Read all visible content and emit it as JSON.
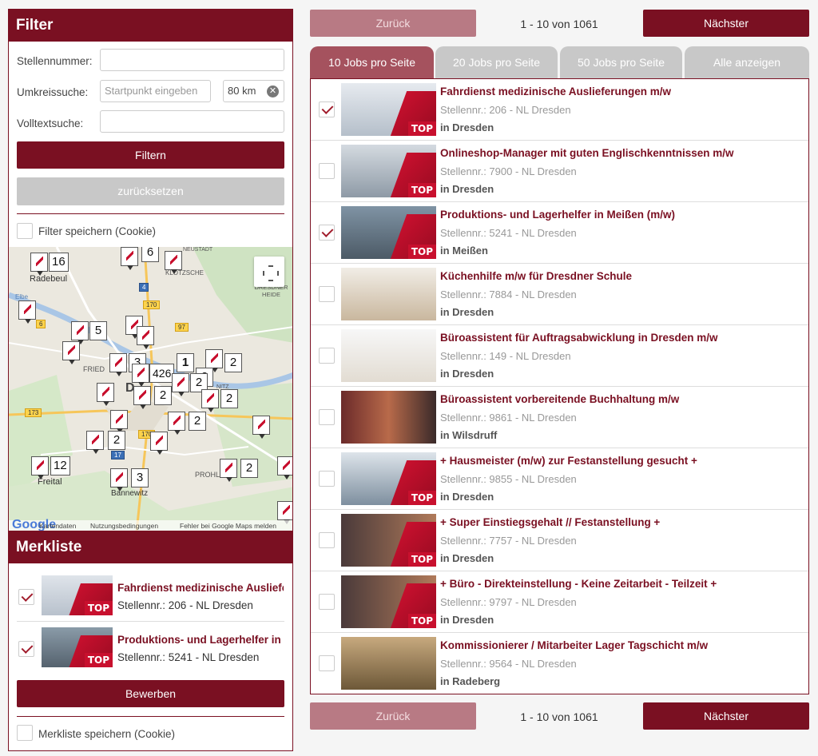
{
  "filter": {
    "title": "Filter",
    "stellennummer_label": "Stellennummer:",
    "stellennummer_value": "",
    "umkreis_label": "Umkreissuche:",
    "startpunkt_placeholder": "Startpunkt eingeben",
    "radius_value": "80 km",
    "volltext_label": "Volltextsuche:",
    "volltext_value": "",
    "filter_button": "Filtern",
    "reset_button": "zurücksetzen",
    "save_cookie_label": "Filter speichern (Cookie)"
  },
  "map": {
    "place_labels": [
      "Radebeul",
      "KLOTZSCHE",
      "DRESDNER HEIDE",
      "Elbe",
      "FRIED",
      "D",
      "PROHL",
      "Freital",
      "Bannewitz",
      "NEUSTADT",
      "NITZ"
    ],
    "road_labels": [
      "4",
      "170",
      "97",
      "6",
      "173",
      "170",
      "17"
    ],
    "cluster_counts": [
      "16",
      "6",
      "5",
      "3",
      "426",
      "1",
      "2",
      "2",
      "2",
      "2",
      "2",
      "2",
      "12",
      "3",
      "2",
      "2"
    ],
    "footer_google": "Google",
    "footer_links": [
      "Kartendaten",
      "Nutzungsbedingungen",
      "Fehler bei Google Maps melden"
    ]
  },
  "merkliste": {
    "title": "Merkliste",
    "items": [
      {
        "title": "Fahrdienst medizinische Auslieferungen m/w",
        "nr": "Stellennr.: 206 - NL Dresden",
        "top": "TOP",
        "checked": true
      },
      {
        "title": "Produktions- und Lagerhelfer in Meißen (m/w)",
        "nr": "Stellennr.: 5241 - NL Dresden",
        "top": "TOP",
        "checked": true
      }
    ],
    "apply_button": "Bewerben",
    "save_cookie_label": "Merkliste speichern (Cookie)"
  },
  "pager": {
    "prev": "Zurück",
    "next": "Nächster",
    "info": "1 - 10 von 1061"
  },
  "tabs": [
    "10 Jobs pro Seite",
    "20 Jobs pro Seite",
    "50 Jobs pro Seite",
    "Alle anzeigen"
  ],
  "jobs": [
    {
      "title": "Fahrdienst medizinische Auslieferungen m/w",
      "nr": "Stellennr.: 206 - NL Dresden",
      "loc": "in Dresden",
      "top": "TOP",
      "checked": true
    },
    {
      "title": "Onlineshop-Manager mit guten Englischkenntnissen m/w",
      "nr": "Stellennr.: 7900 - NL Dresden",
      "loc": "in Dresden",
      "top": "TOP",
      "checked": false
    },
    {
      "title": "Produktions- und Lagerhelfer in Meißen (m/w)",
      "nr": "Stellennr.: 5241 - NL Dresden",
      "loc": "in Meißen",
      "top": "TOP",
      "checked": true
    },
    {
      "title": "Küchenhilfe m/w für Dresdner Schule",
      "nr": "Stellennr.: 7884 - NL Dresden",
      "loc": "in Dresden",
      "top": "",
      "checked": false
    },
    {
      "title": "Büroassistent für Auftragsabwicklung in Dresden m/w",
      "nr": "Stellennr.: 149 - NL Dresden",
      "loc": "in Dresden",
      "top": "",
      "checked": false
    },
    {
      "title": "Büroassistent vorbereitende Buchhaltung m/w",
      "nr": "Stellennr.: 9861 - NL Dresden",
      "loc": "in Wilsdruff",
      "top": "",
      "checked": false
    },
    {
      "title": "+ Hausmeister (m/w) zur Festanstellung gesucht +",
      "nr": "Stellennr.: 9855 - NL Dresden",
      "loc": "in Dresden",
      "top": "TOP",
      "checked": false
    },
    {
      "title": "+ Super Einstiegsgehalt // Festanstellung +",
      "nr": "Stellennr.: 7757 - NL Dresden",
      "loc": "in Dresden",
      "top": "TOP",
      "checked": false
    },
    {
      "title": "+ Büro - Direkteinstellung - Keine Zeitarbeit - Teilzeit +",
      "nr": "Stellennr.: 9797 - NL Dresden",
      "loc": "in Dresden",
      "top": "TOP",
      "checked": false
    },
    {
      "title": "Kommissionierer / Mitarbeiter Lager Tagschicht m/w",
      "nr": "Stellennr.: 9564 - NL Dresden",
      "loc": "in Radeberg",
      "top": "",
      "checked": false
    }
  ],
  "colors": {
    "brand": "#7a1022",
    "brand_light": "#a5525e",
    "top_red": "#c8102e"
  }
}
